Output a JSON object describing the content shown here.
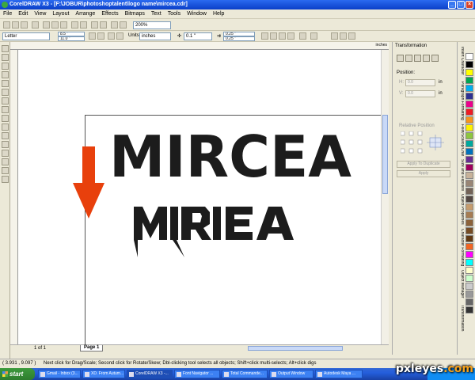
{
  "window": {
    "title": "CorelDRAW X3 - [F:\\JOBUR\\photoshoptalent\\logo name\\mircea.cdr]",
    "controls": [
      "_",
      "□",
      "×"
    ]
  },
  "menu": [
    "File",
    "Edit",
    "View",
    "Layout",
    "Arrange",
    "Effects",
    "Bitmaps",
    "Text",
    "Tools",
    "Window",
    "Help"
  ],
  "toolbar1": {
    "zoom": "200%"
  },
  "toolbar2": {
    "paper": "Letter",
    "width": "8.5 \"",
    "height": "11.0 \"",
    "units_label": "Units:",
    "units": "inches",
    "nudge": "0.1 \"",
    "dup_x": "0.25 \"",
    "dup_y": "0.25 \""
  },
  "ruler": {
    "unit": "inches"
  },
  "canvas": {
    "logo_top": "MIRCEA",
    "logo_bottom_glyphs": [
      "M",
      "I",
      "R",
      "E",
      "A"
    ]
  },
  "page_nav": {
    "count": "1 of 1",
    "tab": "Page 1"
  },
  "docker": {
    "title": "Transformation",
    "position_label": "Position:",
    "h_label": "H:",
    "h_value": "0.0",
    "v_label": "V:",
    "v_value": "0.0",
    "unit": "in",
    "relative_label": "Relative Position",
    "apply_dup": "Apply To Duplicate",
    "apply": "Apply"
  },
  "side_tabs": [
    "Insert Character",
    "Paragraph Formatting",
    "Fillet/Scallop/Chamfer",
    "Size and Reposition",
    "Object Properties",
    "Character Formatting",
    "Object Manager",
    "Transformation"
  ],
  "palette_colors": [
    "#ffffff",
    "#000000",
    "#ffff00",
    "#00a651",
    "#00aeef",
    "#2e3192",
    "#ec008c",
    "#ed1c24",
    "#f7941d",
    "#fff200",
    "#8dc63f",
    "#00a99d",
    "#0072bc",
    "#662d91",
    "#9e005d",
    "#c7b299",
    "#998675",
    "#736357",
    "#534741",
    "#c69c6d",
    "#a67c52",
    "#8c6239",
    "#754c24",
    "#603913",
    "#f26522",
    "#ff00ff",
    "#00ffff",
    "#ffffcc",
    "#ccffcc",
    "#cccccc",
    "#999999",
    "#666666",
    "#333333"
  ],
  "status": {
    "coords": "( 3.931 , 9.097 )",
    "hint": "Next click for Drag/Scale; Second click for Rotate/Skew; Dbl-clicking tool selects all objects; Shift+click multi-selects; Alt+click digs"
  },
  "taskbar": {
    "start": "start",
    "tasks": [
      "Gmail - Inbox (3...",
      "XD. From Autum...",
      "CorelDRAW X3 -...",
      "Font Navigator ...",
      "Total Commande...",
      "Output Window",
      "Autodesk Maya ..."
    ],
    "watermark_main": "pxl",
    "watermark_e": "e",
    "watermark_end": "yes",
    "watermark_dot": ".com"
  },
  "colors": {
    "arrow": "#e8400c",
    "logo": "#1c1c1c"
  }
}
